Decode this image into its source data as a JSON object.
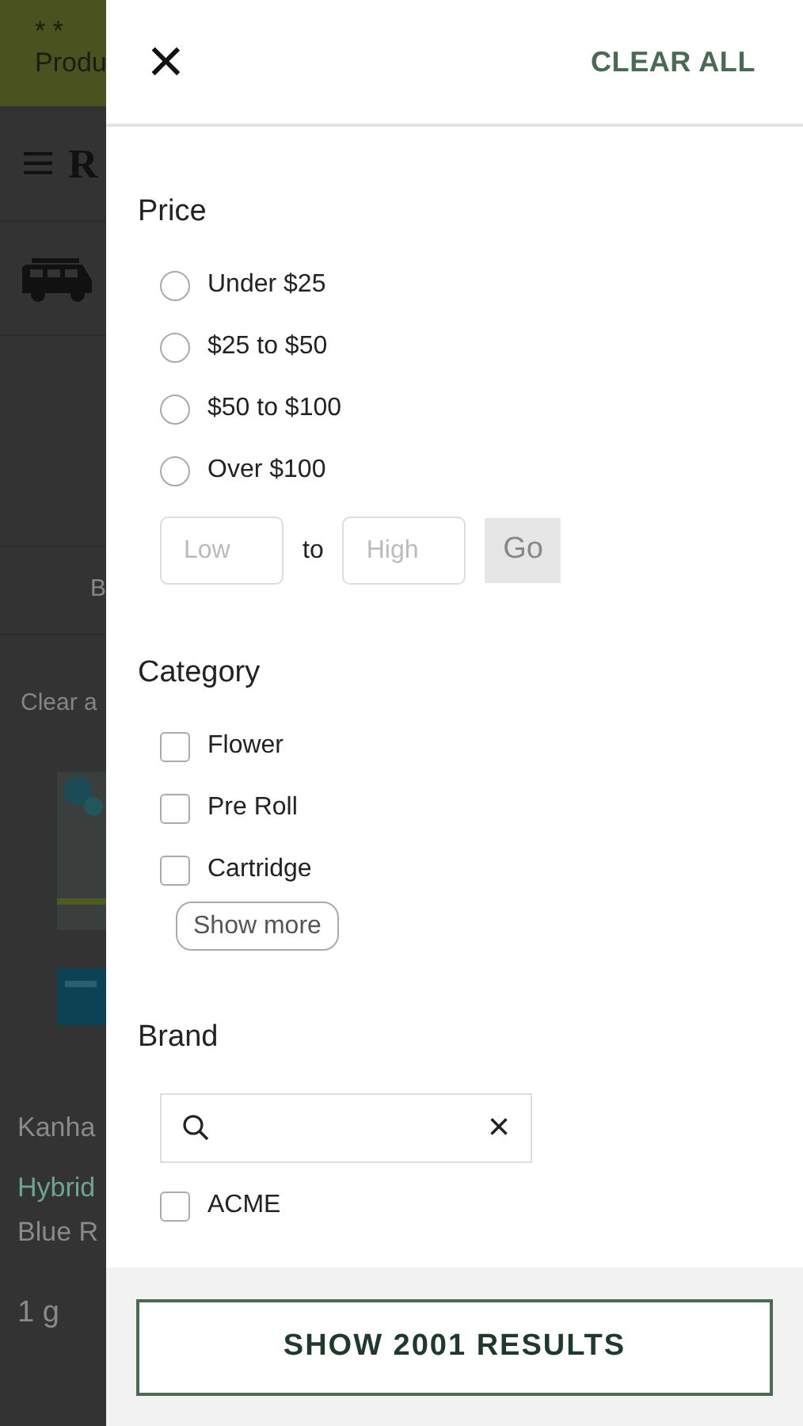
{
  "background_page": {
    "banner": {
      "stars": "* *",
      "text": "Produ"
    },
    "logo": "R",
    "tab_label": "B",
    "clear_link": "Clear a",
    "product": {
      "kind": "picture",
      "name": "Kanha",
      "strain": "Hybrid",
      "flavor": "Blue R",
      "size": "1 g"
    }
  },
  "drawer": {
    "close": "×",
    "clear_all": "CLEAR ALL",
    "price": {
      "title": "Price",
      "options": [
        {
          "label": "Under $25",
          "selected": false
        },
        {
          "label": "$25 to $50",
          "selected": false
        },
        {
          "label": "$50 to $100",
          "selected": false
        },
        {
          "label": "Over $100",
          "selected": false
        }
      ],
      "low": {
        "placeholder": "Low"
      },
      "to": "to",
      "high": {
        "placeholder": "High"
      },
      "go": "Go"
    },
    "category": {
      "title": "Category",
      "options": [
        {
          "label": "Flower",
          "checked": false
        },
        {
          "label": "Pre Roll",
          "checked": false
        },
        {
          "label": "Cartridge",
          "checked": false
        }
      ],
      "show_more": "Show more"
    },
    "brand": {
      "title": "Brand",
      "clear": "×",
      "options": [
        {
          "label": "ACME",
          "checked": false
        }
      ]
    },
    "show_results": "SHOW 2001 RESULTS"
  }
}
